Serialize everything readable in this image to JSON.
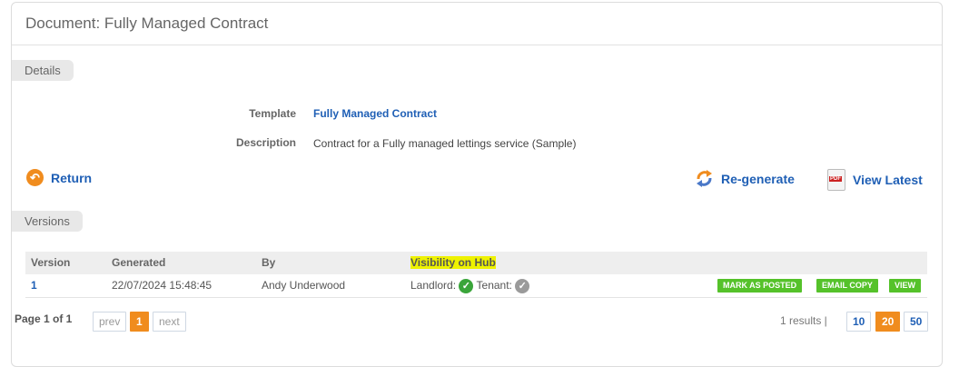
{
  "header": {
    "title": "Document: Fully Managed Contract"
  },
  "details": {
    "tab_label": "Details",
    "fields": [
      {
        "label": "Template",
        "value": "Fully Managed Contract"
      },
      {
        "label": "Description",
        "value": "Contract for a Fully managed lettings service (Sample)"
      }
    ]
  },
  "actions": {
    "return_label": "Return",
    "regenerate_label": "Re-generate",
    "view_latest_label": "View Latest",
    "pdf_icon_text": "PDF"
  },
  "versions": {
    "tab_label": "Versions",
    "columns": [
      "Version",
      "Generated",
      "By",
      "Visibility on Hub"
    ],
    "rows": [
      {
        "version": "1",
        "generated": "22/07/2024 15:48:45",
        "by": "Andy Underwood",
        "landlord_label": "Landlord:",
        "tenant_label": "Tenant:",
        "landlord_visible": true,
        "tenant_visible": false,
        "buttons": [
          "MARK AS POSTED",
          "EMAIL COPY",
          "VIEW"
        ]
      }
    ]
  },
  "pagination": {
    "page_label": "Page 1 of 1",
    "prev": "prev",
    "current": "1",
    "next": "next",
    "results": "1 results |",
    "page_sizes": [
      "10",
      "20",
      "50"
    ],
    "active_page_size": "20"
  },
  "colors": {
    "accent_orange": "#f08c1e",
    "link_blue": "#1f5fb5",
    "button_green": "#55c22a",
    "highlight_yellow": "#eef200"
  }
}
